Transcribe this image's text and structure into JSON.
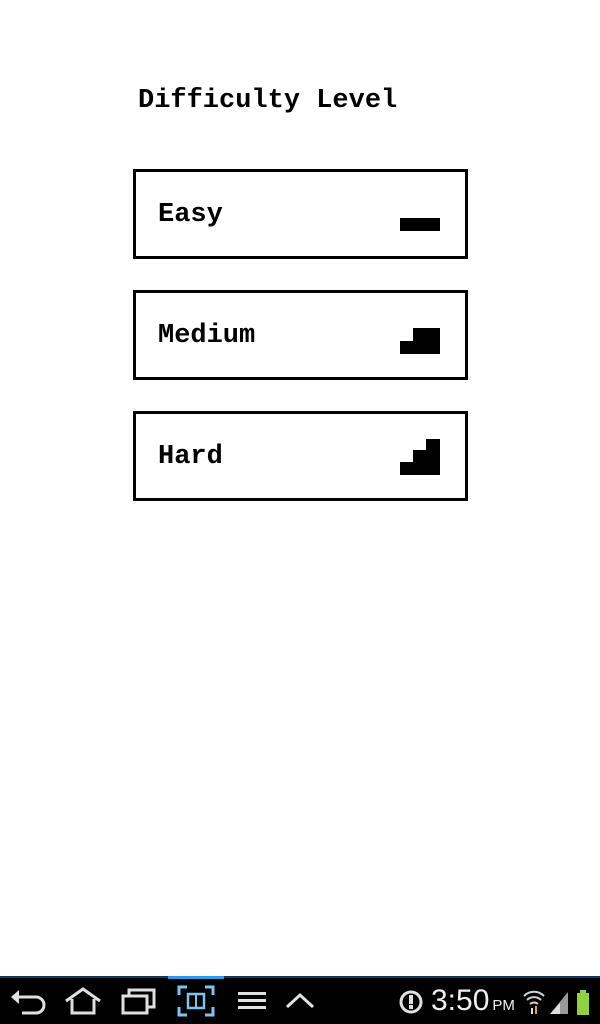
{
  "screen": {
    "title": "Difficulty Level",
    "options": [
      {
        "label": "Easy",
        "level": 1
      },
      {
        "label": "Medium",
        "level": 2
      },
      {
        "label": "Hard",
        "level": 3
      }
    ]
  },
  "system_bar": {
    "time": "3:50",
    "ampm": "PM",
    "nav_icons": [
      "back-icon",
      "home-icon",
      "recent-apps-icon",
      "screenshot-icon",
      "menu-icon",
      "up-arrow-icon"
    ],
    "status_icons": [
      "sync-icon",
      "wifi-icon",
      "signal-icon",
      "battery-icon"
    ],
    "colors": {
      "background": "#000000",
      "accent": "#2e9be6",
      "battery": "#8fd13f"
    }
  }
}
